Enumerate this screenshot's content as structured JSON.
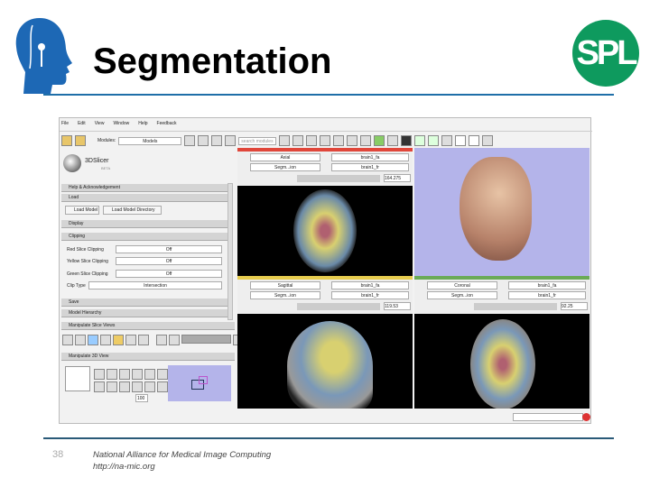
{
  "slide": {
    "title": "Segmentation",
    "page_number": "38",
    "footer_line1": "National Alliance for Medical Image Computing",
    "footer_line2": "http://na-mic.org",
    "logo_right": "SPL"
  },
  "app": {
    "menu": [
      "File",
      "Edit",
      "View",
      "Window",
      "Help",
      "Feedback"
    ],
    "toolbar": {
      "modules_label": "Modules:",
      "module_value": "Models",
      "search_placeholder": "search modules"
    },
    "logo": {
      "name": "3DSlicer",
      "version": "BETA"
    },
    "panels": {
      "help": "Help & Acknowledgement",
      "load": "Load",
      "load_model": "Load Model",
      "load_model_dir": "Load Model Directory",
      "display": "Display",
      "clipping": "Clipping",
      "save": "Save",
      "hierarchy": "Model Hierarchy",
      "slice_views": "Manipulate Slice Views",
      "view_3d": "Manipulate 3D View",
      "zoom_value": "100"
    },
    "clipping": [
      {
        "label": "Red Slice Clipping",
        "value": "Off"
      },
      {
        "label": "Yellow Slice Clipping",
        "value": "Off"
      },
      {
        "label": "Green Slice Clipping",
        "value": "Off"
      },
      {
        "label": "Clip Type",
        "value": "Intersection"
      }
    ],
    "views": [
      {
        "orientation": "Axial",
        "fg": "brain1_fa",
        "label": "Segm...ion",
        "bg": "brain1_fr",
        "offset": "164.275",
        "color": "#e0463a"
      },
      {
        "orientation": "Sagittal",
        "fg": "brain1_fa",
        "label": "Segm...ion",
        "bg": "brain1_fr",
        "offset": "119.53",
        "color": "#e6cc4e"
      },
      {
        "orientation": "Coronal",
        "fg": "brain1_fa",
        "label": "Segm...ion",
        "bg": "brain1_fr",
        "offset": "92.25",
        "color": "#6aaa56"
      }
    ]
  }
}
